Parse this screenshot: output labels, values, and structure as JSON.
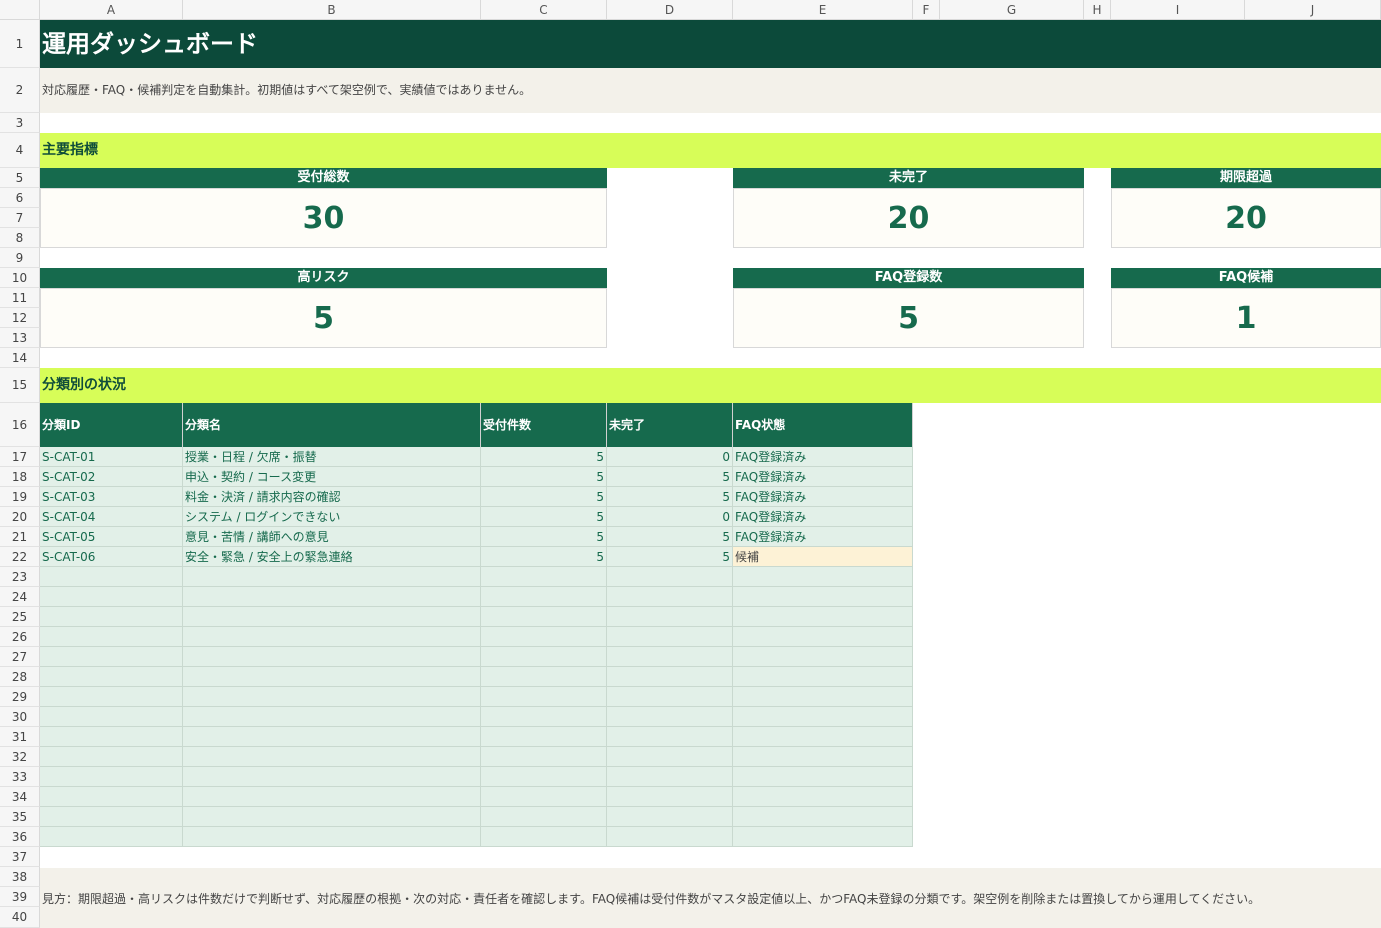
{
  "columns": [
    "A",
    "B",
    "C",
    "D",
    "E",
    "F",
    "G",
    "H",
    "I",
    "J"
  ],
  "rows": [
    "1",
    "2",
    "3",
    "4",
    "5",
    "6",
    "7",
    "8",
    "9",
    "10",
    "11",
    "12",
    "13",
    "14",
    "15",
    "16",
    "17",
    "18",
    "19",
    "20",
    "21",
    "22",
    "23",
    "24",
    "25",
    "26",
    "27",
    "28",
    "29",
    "30",
    "31",
    "32",
    "33",
    "34",
    "35",
    "36",
    "37",
    "38",
    "39",
    "40"
  ],
  "title": "運用ダッシュボード",
  "description": "対応履歴・FAQ・候補判定を自動集計。初期値はすべて架空例で、実績値ではありません。",
  "kpi_section": "主要指標",
  "kpis": [
    {
      "label": "受付総数",
      "value": "30"
    },
    {
      "label": "未完了",
      "value": "20"
    },
    {
      "label": "期限超過",
      "value": "20"
    },
    {
      "label": "高リスク",
      "value": "5"
    },
    {
      "label": "FAQ登録数",
      "value": "5"
    },
    {
      "label": "FAQ候補",
      "value": "1"
    }
  ],
  "category_section": "分類別の状況",
  "table": {
    "headers": [
      "分類ID",
      "分類名",
      "受付件数",
      "未完了",
      "FAQ状態"
    ],
    "rows": [
      {
        "id": "S-CAT-01",
        "name": "授業・日程 / 欠席・振替",
        "count": "5",
        "open": "0",
        "faq": "FAQ登録済み"
      },
      {
        "id": "S-CAT-02",
        "name": "申込・契約 / コース変更",
        "count": "5",
        "open": "5",
        "faq": "FAQ登録済み"
      },
      {
        "id": "S-CAT-03",
        "name": "料金・決済 / 請求内容の確認",
        "count": "5",
        "open": "5",
        "faq": "FAQ登録済み"
      },
      {
        "id": "S-CAT-04",
        "name": "システム / ログインできない",
        "count": "5",
        "open": "0",
        "faq": "FAQ登録済み"
      },
      {
        "id": "S-CAT-05",
        "name": "意見・苦情 / 講師への意見",
        "count": "5",
        "open": "5",
        "faq": "FAQ登録済み"
      },
      {
        "id": "S-CAT-06",
        "name": "安全・緊急 / 安全上の緊急連絡",
        "count": "5",
        "open": "5",
        "faq": "候補"
      }
    ]
  },
  "footer_note": "見方：期限超過・高リスクは件数だけで判断せず、対応履歴の根拠・次の対応・責任者を確認します。FAQ候補は受付件数がマスタ設定値以上、かつFAQ未登録の分類です。架空例を削除または置換してから運用してください。",
  "colors": {
    "dark_green": "#0c4a3a",
    "header_green": "#166a4d",
    "lime": "#d7fd58",
    "table_fill": "#e2f0e8",
    "candidate_fill": "#fdf2d6"
  }
}
